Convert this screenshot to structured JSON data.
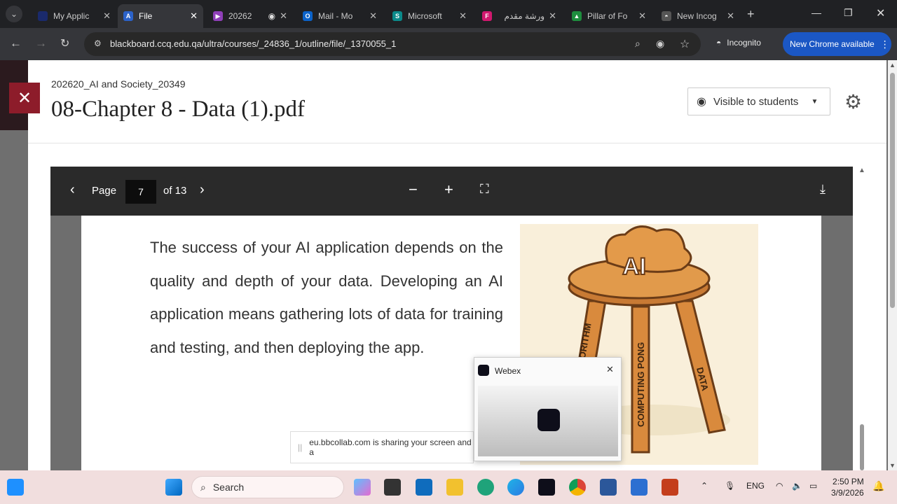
{
  "browser": {
    "tabs": [
      {
        "title": "My Applic",
        "active": false,
        "favicon_color": "#1a2a6c"
      },
      {
        "title": "File",
        "active": true,
        "favicon_color": "#2b62c9"
      },
      {
        "title": "20262",
        "active": false,
        "favicon_color": "#8f3fb8"
      },
      {
        "title": "Mail - Mo",
        "active": false,
        "favicon_color": "#0b62c9"
      },
      {
        "title": "Microsoft",
        "active": false,
        "favicon_color": "#0b8a8a"
      },
      {
        "title": "ورشة مقدم",
        "active": false,
        "favicon_color": "#d0186e"
      },
      {
        "title": "Pillar of Fo",
        "active": false,
        "favicon_color": "#1e8e3e"
      },
      {
        "title": "New Incog",
        "active": false,
        "favicon_color": "#888888"
      }
    ],
    "url": "blackboard.ccq.edu.qa/ultra/courses/_24836_1/outline/file/_1370055_1",
    "incognito_label": "Incognito",
    "update_label": "New Chrome available"
  },
  "page": {
    "course_name": "202620_AI and Society_20349",
    "file_title": "08-Chapter 8 - Data (1).pdf",
    "visibility_label": "Visible to students"
  },
  "viewer": {
    "page_label": "Page",
    "current_page": "7",
    "of_label": "of 13",
    "body_text": "The success of your AI application depends on the quality and depth of your data. Developing an AI application means gathering lots of data for training and testing, and then deploying the app.",
    "illustration": {
      "seat_label": "AI",
      "leg_left": "ALGORITHM",
      "leg_middle": "COMPUTING PONG",
      "leg_right": "DATA"
    }
  },
  "webex": {
    "title": "Webex"
  },
  "share_notice": "eu.bbcollab.com is sharing your screen and a",
  "taskbar": {
    "search_placeholder": "Search",
    "language": "ENG",
    "time": "2:50 PM",
    "date": "3/9/2026"
  },
  "colors": {
    "blackboard_red": "#8d1c2a",
    "viewer_bar": "#2a2a2a",
    "chrome_update_blue": "#1b57c4"
  }
}
